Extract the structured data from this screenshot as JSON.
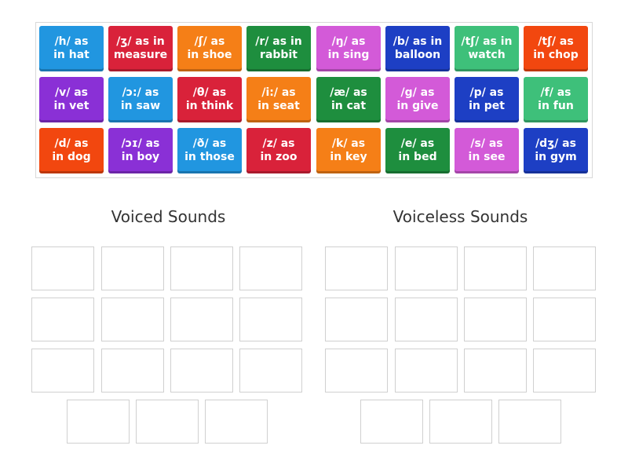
{
  "tiles": [
    {
      "label": "/h/ as\nin hat",
      "color": "#2196e0"
    },
    {
      "label": "/ʒ/ as in\nmeasure",
      "color": "#d9223a"
    },
    {
      "label": "/ʃ/ as\nin shoe",
      "color": "#f57f17"
    },
    {
      "label": "/r/ as in\nrabbit",
      "color": "#1e8e3e"
    },
    {
      "label": "/ŋ/ as\nin sing",
      "color": "#d35ad8"
    },
    {
      "label": "/b/ as in\nballoon",
      "color": "#1d3fc4"
    },
    {
      "label": "/tʃ/ as in\nwatch",
      "color": "#3ec07a"
    },
    {
      "label": "/tʃ/ as\nin chop",
      "color": "#f2470f"
    },
    {
      "label": "/v/ as\nin vet",
      "color": "#8a30d6"
    },
    {
      "label": "/ɔ:/ as\nin saw",
      "color": "#2196e0"
    },
    {
      "label": "/θ/ as\nin think",
      "color": "#d9223a"
    },
    {
      "label": "/i:/ as\nin seat",
      "color": "#f57f17"
    },
    {
      "label": "/æ/ as\nin cat",
      "color": "#1e8e3e"
    },
    {
      "label": "/g/ as\nin give",
      "color": "#d35ad8"
    },
    {
      "label": "/p/ as\nin pet",
      "color": "#1d3fc4"
    },
    {
      "label": "/f/ as\nin fun",
      "color": "#3ec07a"
    },
    {
      "label": "/d/ as\nin dog",
      "color": "#f2470f"
    },
    {
      "label": "/ɔɪ/ as\nin boy",
      "color": "#8a30d6"
    },
    {
      "label": "/ð/ as\nin those",
      "color": "#2196e0"
    },
    {
      "label": "/z/ as\nin zoo",
      "color": "#d9223a"
    },
    {
      "label": "/k/ as\nin key",
      "color": "#f57f17"
    },
    {
      "label": "/e/ as\nin bed",
      "color": "#1e8e3e"
    },
    {
      "label": "/s/ as\nin see",
      "color": "#d35ad8"
    },
    {
      "label": "/dʒ/ as\nin gym",
      "color": "#1d3fc4"
    }
  ],
  "groups": {
    "voiced": {
      "title": "Voiced Sounds"
    },
    "voiceless": {
      "title": "Voiceless Sounds"
    }
  }
}
